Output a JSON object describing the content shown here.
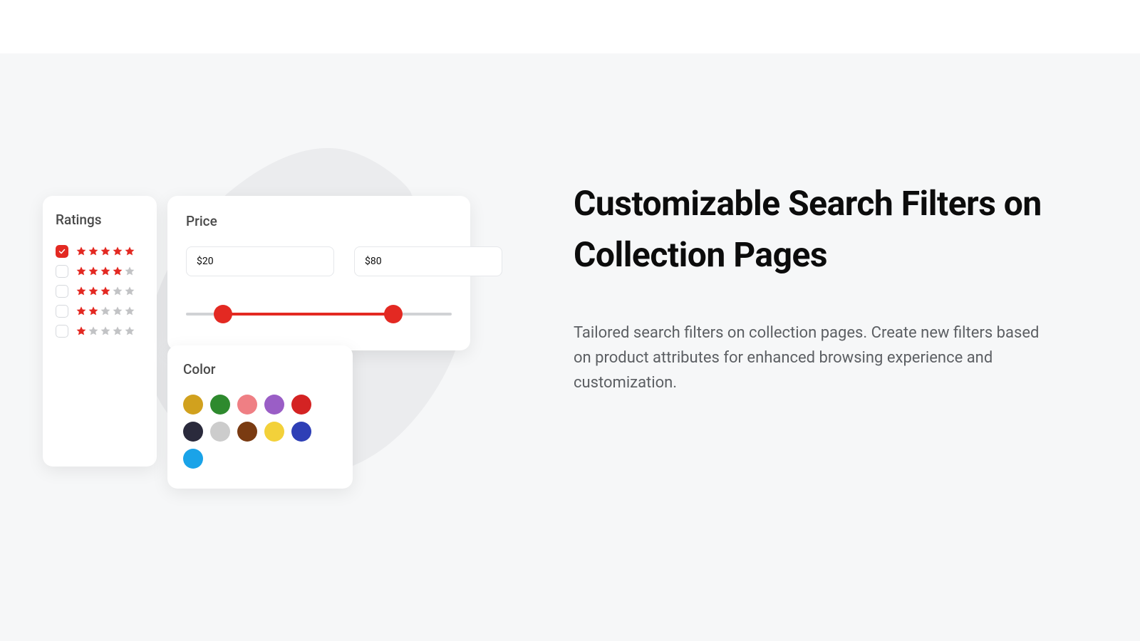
{
  "headline": "Customizable Search Filters on Collection Pages",
  "description": "Tailored search filters on collection pages. Create new filters based on  product attributes for enhanced browsing experience and customization.",
  "ratings": {
    "title": "Ratings",
    "rows": [
      {
        "filled": 5,
        "checked": true
      },
      {
        "filled": 4,
        "checked": false
      },
      {
        "filled": 3,
        "checked": false
      },
      {
        "filled": 2,
        "checked": false
      },
      {
        "filled": 1,
        "checked": false
      }
    ]
  },
  "price": {
    "title": "Price",
    "min": "$20",
    "max": "$80"
  },
  "color": {
    "title": "Color",
    "swatches": [
      "#d1a11e",
      "#2e8a2e",
      "#ef7f84",
      "#9a5ec6",
      "#d42323",
      "#2a2a3c",
      "#cccccc",
      "#7a3b12",
      "#f3d13a",
      "#2e3fb6",
      "#1aa3e8"
    ]
  }
}
